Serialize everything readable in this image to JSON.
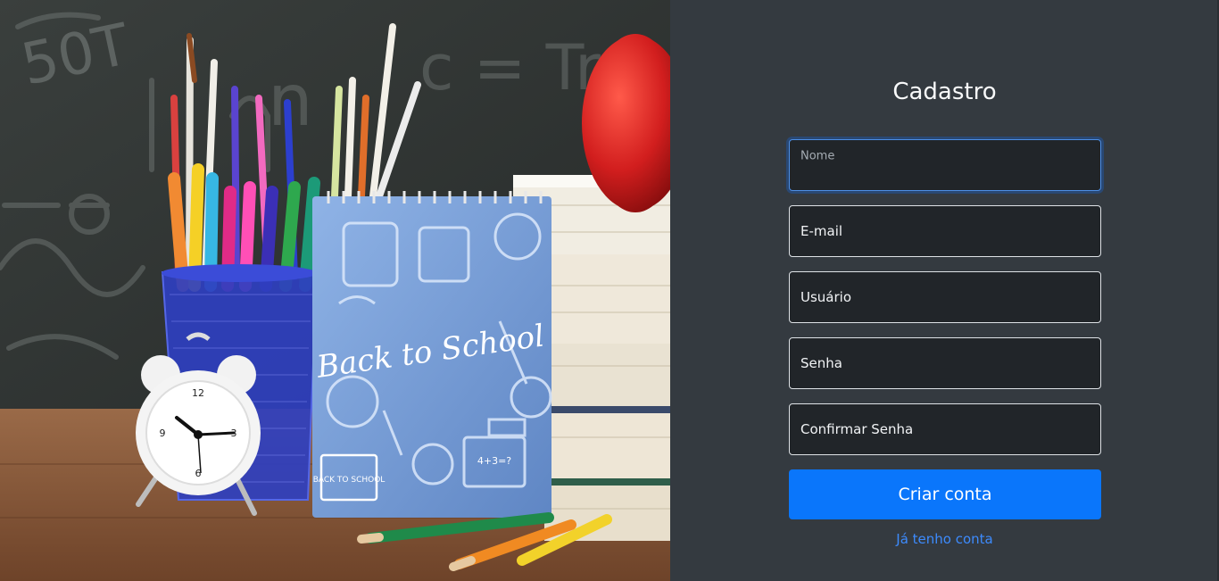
{
  "hero": {
    "chalkboard_text": [
      "50T",
      "n",
      "c = Tr"
    ],
    "notebook": {
      "cover_text": "Back to School",
      "mini_text": "BACK TO SCHOOL",
      "laptop_text": "4+3=?"
    },
    "colors": {
      "chalkboard": "#2e3332",
      "desk": "#8a5a3c",
      "notebook": "#7da3d8",
      "apple": "#d21e1e",
      "cup": "#2f3fbf"
    }
  },
  "form": {
    "title": "Cadastro",
    "fields": [
      {
        "label": "Nome",
        "value": "",
        "state": "focused"
      },
      {
        "label": "E-mail",
        "value": ""
      },
      {
        "label": "Usuário",
        "value": ""
      },
      {
        "label": "Senha",
        "value": ""
      },
      {
        "label": "Confirmar Senha",
        "value": ""
      }
    ],
    "submit_label": "Criar conta",
    "login_link": "Já tenho conta"
  },
  "colors": {
    "panel_bg": "#343a40",
    "field_bg": "#212529",
    "primary": "#0d6efd",
    "link": "#3d8bfd"
  }
}
